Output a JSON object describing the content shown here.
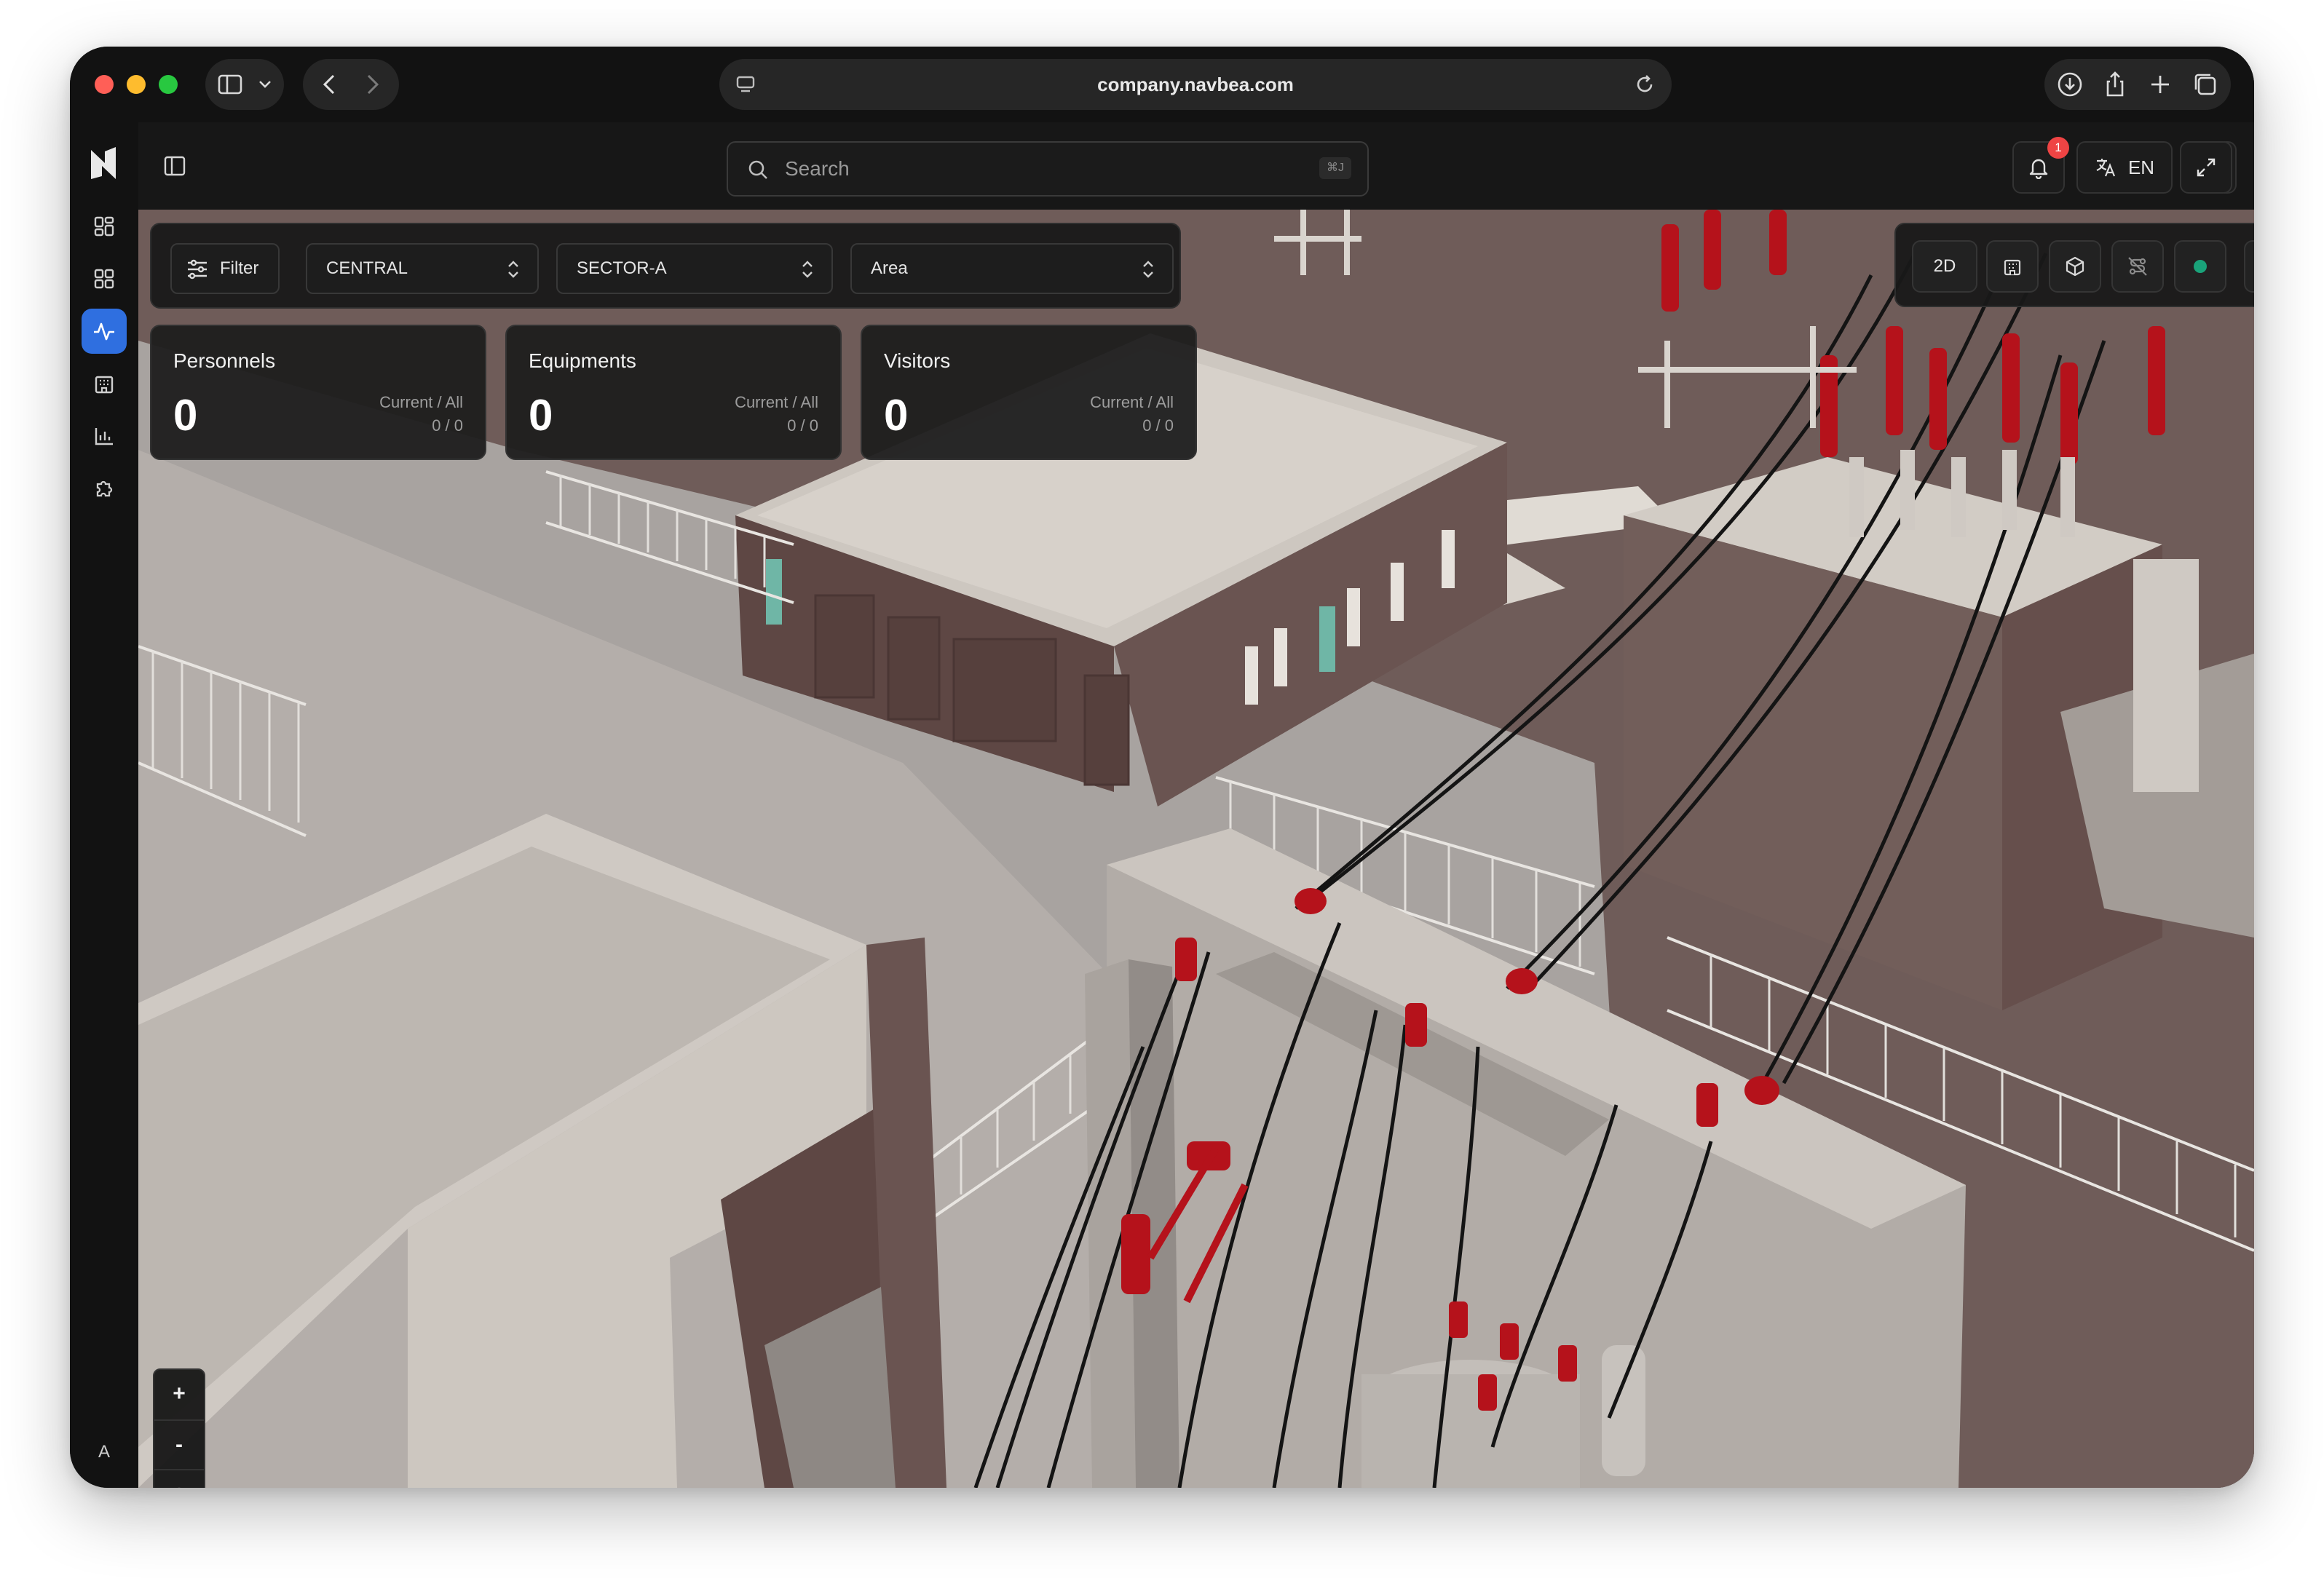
{
  "browser": {
    "url": "company.navbea.com"
  },
  "header": {
    "search_placeholder": "Search",
    "search_shortcut": "⌘J",
    "notification_count": "1",
    "language": "EN"
  },
  "sidebar": {
    "items": [
      {
        "icon": "dashboard-grid-icon"
      },
      {
        "icon": "apps-grid-icon"
      },
      {
        "icon": "activity-pulse-icon",
        "active": true
      },
      {
        "icon": "building-icon"
      },
      {
        "icon": "bar-chart-icon"
      },
      {
        "icon": "puzzle-icon"
      }
    ],
    "avatar_initial": "A"
  },
  "filters": {
    "filter_label": "Filter",
    "region": "CENTRAL",
    "sector": "SECTOR-A",
    "area": "Area"
  },
  "stats": [
    {
      "title": "Personnels",
      "value": "0",
      "caption": "Current / All",
      "ratio": "0 / 0"
    },
    {
      "title": "Equipments",
      "value": "0",
      "caption": "Current / All",
      "ratio": "0 / 0"
    },
    {
      "title": "Visitors",
      "value": "0",
      "caption": "Current / All",
      "ratio": "0 / 0"
    }
  ],
  "view_controls": {
    "mode_2d_label": "2D",
    "status_color": "#1aa37a"
  },
  "zoom": {
    "plus": "+",
    "minus": "-"
  },
  "colors": {
    "accent": "#2f6fe0",
    "notification": "#ef4444",
    "insulator_red": "#b5121b"
  }
}
